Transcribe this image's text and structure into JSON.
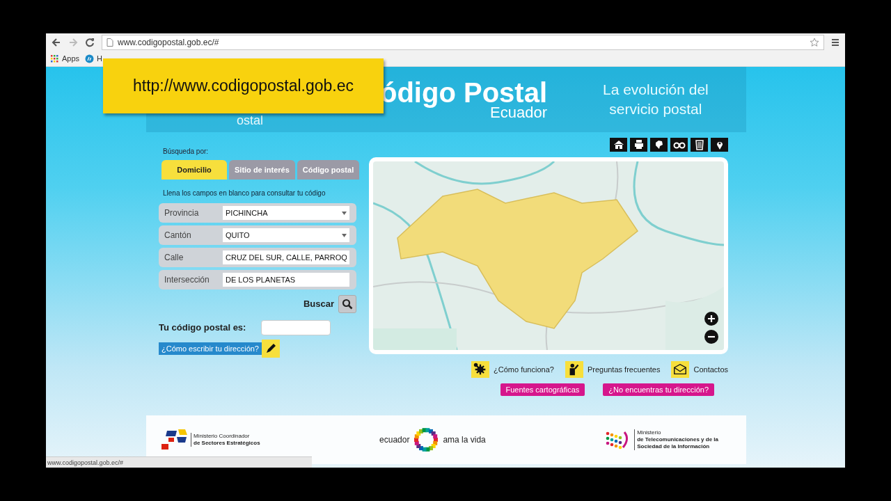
{
  "browser": {
    "url": "www.codigopostal.gob.ec/#",
    "bookmarks": [
      "Apps",
      "H"
    ],
    "status_url": "www.codigopostal.gob.ec/#"
  },
  "overlay": {
    "text": "http://www.codigopostal.gob.ec"
  },
  "header": {
    "logo_text": "ódigo",
    "logo_word": "Postal",
    "logo_sub": "Ecuador",
    "logo_fragment": "ostal",
    "tagline": [
      "La evolución del",
      "servicio postal"
    ]
  },
  "search": {
    "label": "Búsqueda por:",
    "tabs": [
      {
        "label": "Domicilio",
        "selected": true
      },
      {
        "label": "Sitio de interés",
        "selected": false
      },
      {
        "label": "Código postal",
        "selected": false
      }
    ],
    "hint": "Llena los campos en blanco para consultar tu código",
    "fields": [
      {
        "label": "Provincia",
        "value": "PICHINCHA",
        "kind": "select"
      },
      {
        "label": "Cantón",
        "value": "QUITO",
        "kind": "select"
      },
      {
        "label": "Calle",
        "value": "CRUZ DEL SUR, CALLE, PARROQ",
        "kind": "text"
      },
      {
        "label": "Intersección",
        "value": "DE LOS PLANETAS",
        "kind": "text"
      }
    ],
    "search_label": "Buscar"
  },
  "result": {
    "label": "Tu código postal es:"
  },
  "help_button": "¿Cómo escribir tu dirección?",
  "links": [
    "¿Cómo funciona?",
    "Preguntas frecuentes",
    "Contactos"
  ],
  "pink_buttons": [
    "Fuentes cartográficas",
    "¿No encuentras tu dirección?"
  ],
  "footer": {
    "left": [
      "Ministerio Coordinador",
      "de Sectores Estratégicos"
    ],
    "center": [
      "ecuador",
      "ama la vida"
    ],
    "right": [
      "Ministerio",
      "de Telecomunicaciones y de la",
      "Sociedad de la Información"
    ]
  }
}
